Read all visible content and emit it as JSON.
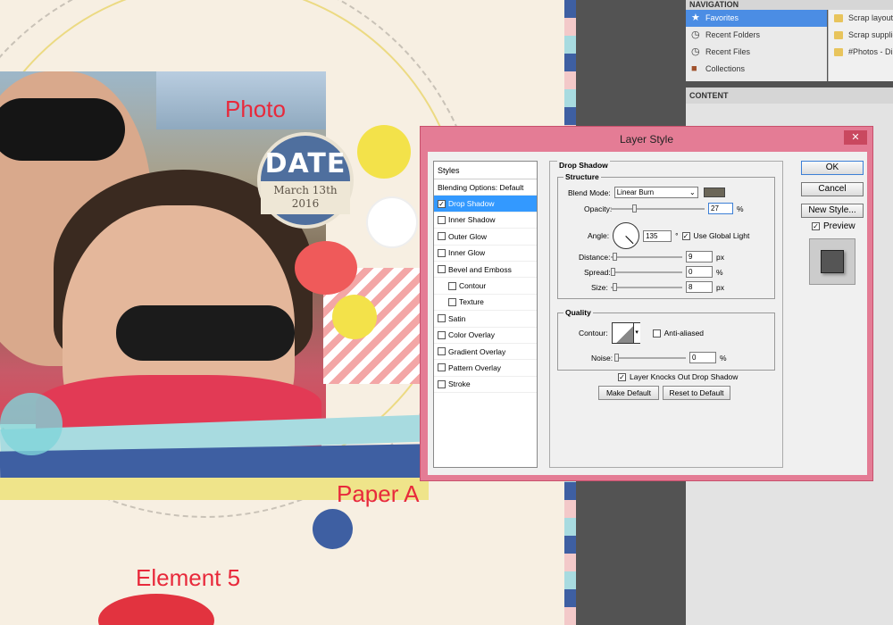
{
  "canvas": {
    "labels": {
      "photo": "Photo",
      "paper": "Paper A",
      "element": "Element 5"
    },
    "date_badge": {
      "title": "DATE",
      "date": "March 13th",
      "year": "2016"
    }
  },
  "navigation": {
    "title": "NAVIGATION",
    "items": [
      {
        "label": "Favorites",
        "icon": "star-icon",
        "selected": true
      },
      {
        "label": "Recent Folders",
        "icon": "clock-icon"
      },
      {
        "label": "Recent Files",
        "icon": "clock-icon"
      },
      {
        "label": "Collections",
        "icon": "collection-icon"
      }
    ],
    "folders": [
      "Scrap layouts",
      "Scrap supplies",
      "#Photos - Di"
    ]
  },
  "content": {
    "title": "CONTENT"
  },
  "dialog": {
    "title": "Layer Style",
    "styles_header": "Styles",
    "styles": [
      {
        "label": "Blending Options: Default",
        "checkbox": false
      },
      {
        "label": "Drop Shadow",
        "checkbox": true,
        "checked": true,
        "selected": true
      },
      {
        "label": "Inner Shadow",
        "checkbox": true
      },
      {
        "label": "Outer Glow",
        "checkbox": true
      },
      {
        "label": "Inner Glow",
        "checkbox": true
      },
      {
        "label": "Bevel and Emboss",
        "checkbox": true
      },
      {
        "label": "Contour",
        "checkbox": true,
        "indent": true
      },
      {
        "label": "Texture",
        "checkbox": true,
        "indent": true
      },
      {
        "label": "Satin",
        "checkbox": true
      },
      {
        "label": "Color Overlay",
        "checkbox": true
      },
      {
        "label": "Gradient Overlay",
        "checkbox": true
      },
      {
        "label": "Pattern Overlay",
        "checkbox": true
      },
      {
        "label": "Stroke",
        "checkbox": true
      }
    ],
    "drop_shadow": {
      "section": "Drop Shadow",
      "structure": "Structure",
      "blend_mode_label": "Blend Mode:",
      "blend_mode": "Linear Burn",
      "opacity_label": "Opacity:",
      "opacity": "27",
      "percent": "%",
      "angle_label": "Angle:",
      "angle": "135",
      "degree": "°",
      "use_global_light": "Use Global Light",
      "distance_label": "Distance:",
      "distance": "9",
      "spread_label": "Spread:",
      "spread": "0",
      "size_label": "Size:",
      "size": "8",
      "px": "px",
      "quality": "Quality",
      "contour_label": "Contour:",
      "anti_aliased": "Anti-aliased",
      "noise_label": "Noise:",
      "noise": "0",
      "layer_knocks_out": "Layer Knocks Out Drop Shadow",
      "make_default": "Make Default",
      "reset_default": "Reset to Default"
    },
    "buttons": {
      "ok": "OK",
      "cancel": "Cancel",
      "new_style": "New Style...",
      "preview": "Preview"
    }
  }
}
